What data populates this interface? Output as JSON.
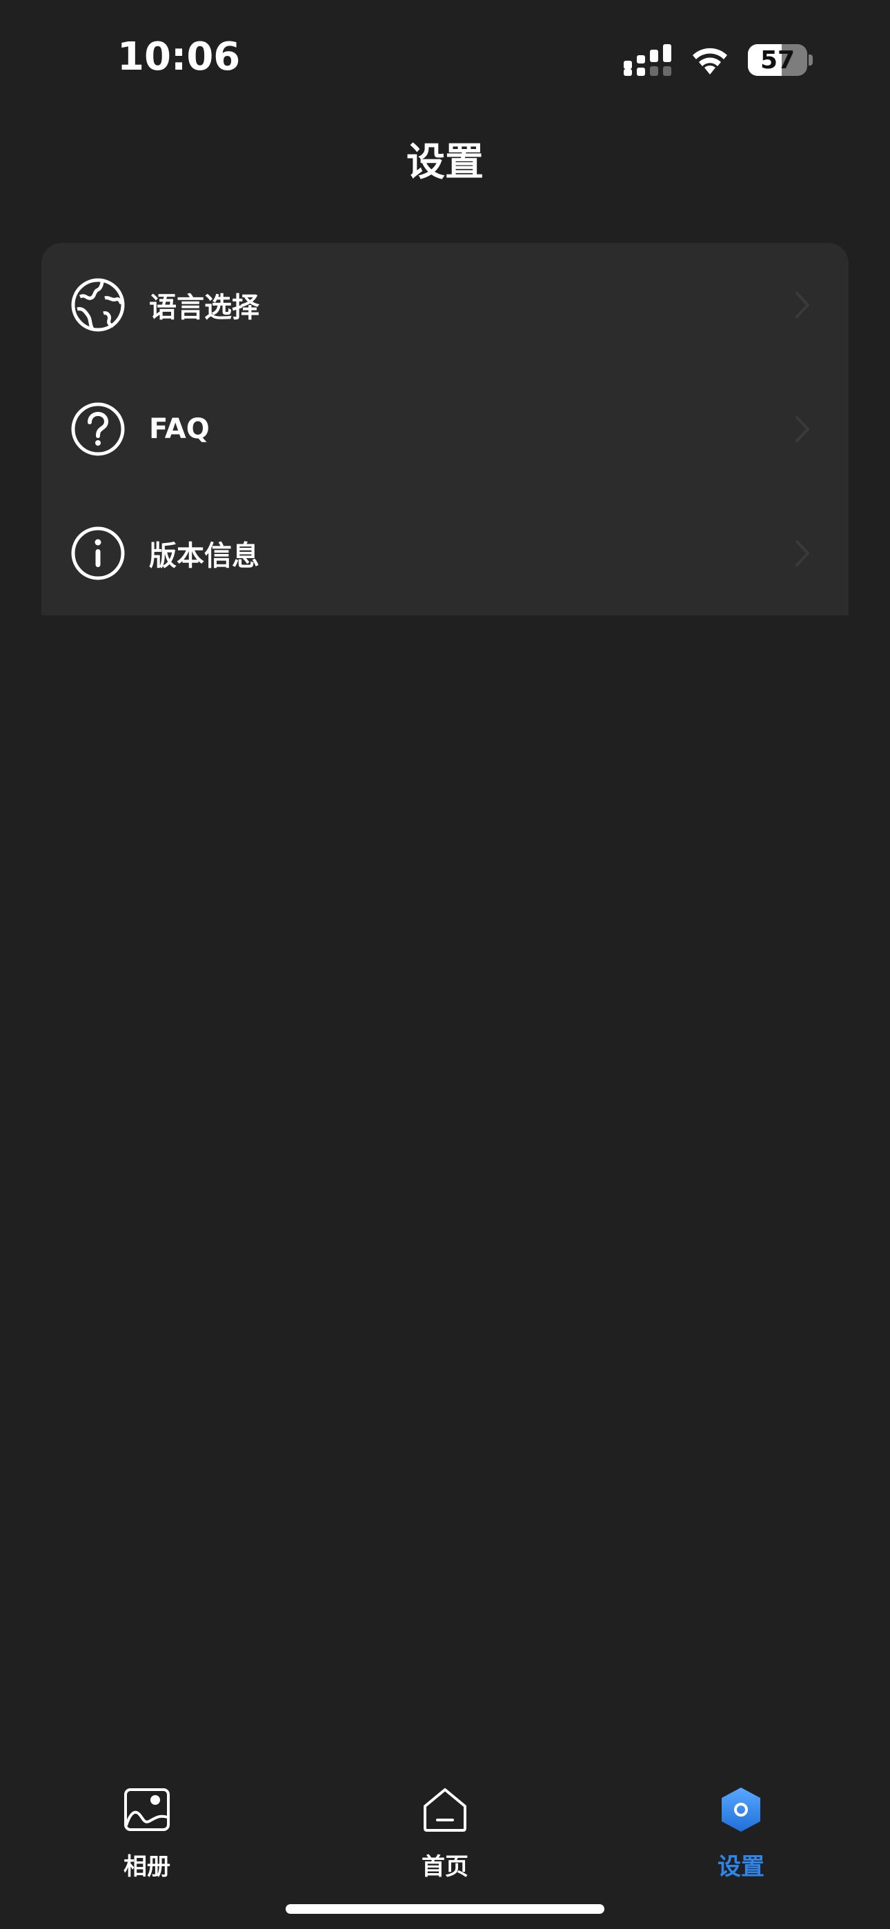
{
  "status_bar": {
    "time": "10:06",
    "battery_level": "57",
    "battery_fraction": 0.57
  },
  "header": {
    "title": "设置"
  },
  "settings": {
    "items": [
      {
        "label": "语言选择",
        "icon": "globe-icon"
      },
      {
        "label": "FAQ",
        "icon": "question-circle-icon"
      },
      {
        "label": "版本信息",
        "icon": "info-circle-icon"
      }
    ]
  },
  "tab_bar": {
    "items": [
      {
        "label": "相册",
        "icon": "photo-album-icon",
        "active": false
      },
      {
        "label": "首页",
        "icon": "home-icon",
        "active": false
      },
      {
        "label": "设置",
        "icon": "settings-hexagon-icon",
        "active": true
      }
    ]
  },
  "colors": {
    "background": "#202020",
    "card": "#2c2c2c",
    "accent": "#2f86e8",
    "text": "#ffffff"
  }
}
